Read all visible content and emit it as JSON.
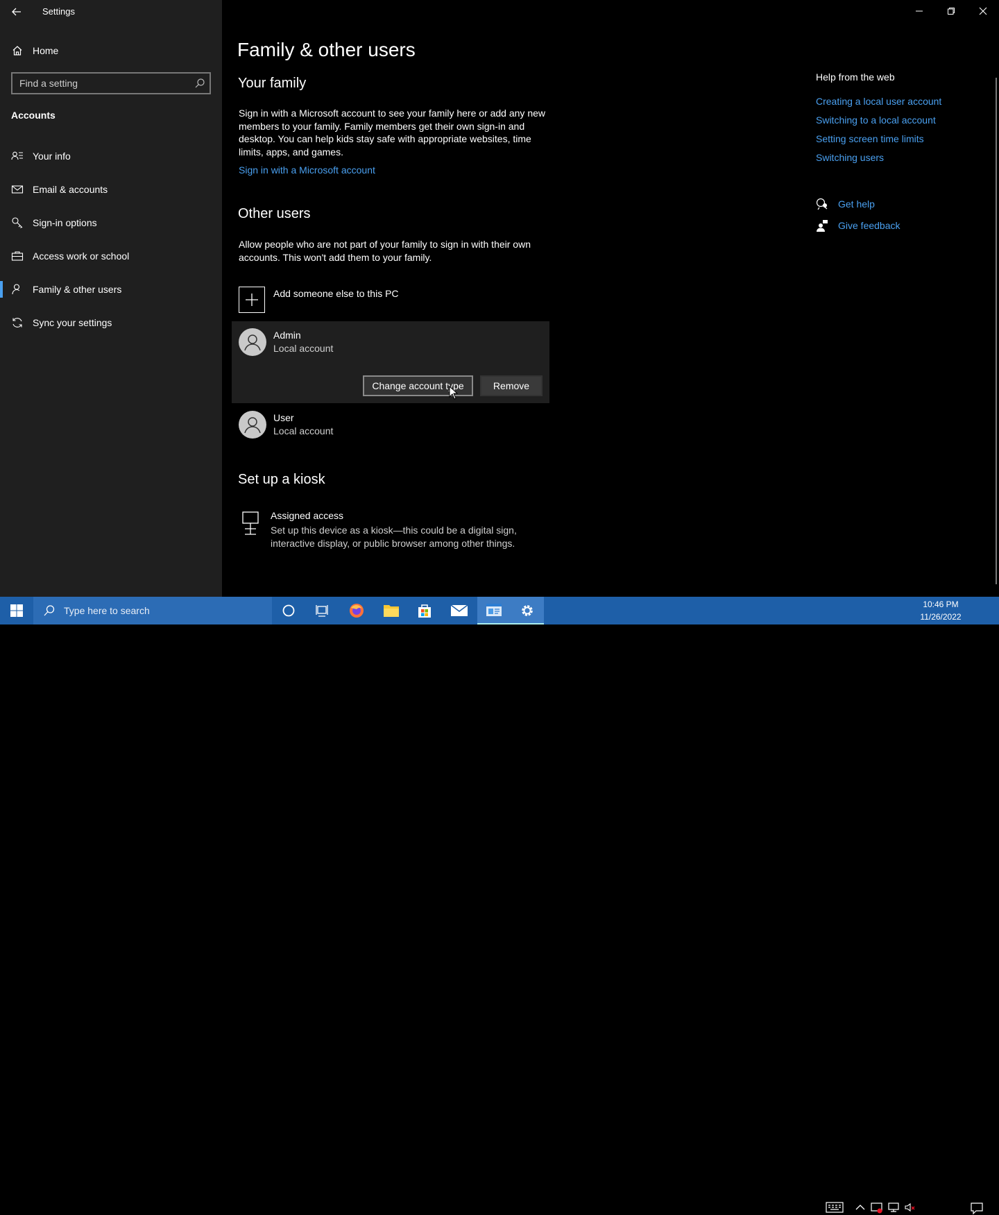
{
  "window": {
    "title": "Settings"
  },
  "sidebar": {
    "home_label": "Home",
    "search_placeholder": "Find a setting",
    "section_title": "Accounts",
    "items": [
      {
        "label": "Your info",
        "icon": "person-list-icon"
      },
      {
        "label": "Email & accounts",
        "icon": "mail-icon"
      },
      {
        "label": "Sign-in options",
        "icon": "key-icon"
      },
      {
        "label": "Access work or school",
        "icon": "briefcase-icon"
      },
      {
        "label": "Family & other users",
        "icon": "person-add-icon",
        "active": true
      },
      {
        "label": "Sync your settings",
        "icon": "sync-icon"
      }
    ]
  },
  "main": {
    "page_title": "Family & other users",
    "your_family": {
      "heading": "Your family",
      "description": "Sign in with a Microsoft account to see your family here or add any new members to your family. Family members get their own sign-in and desktop. You can help kids stay safe with appropriate websites, time limits, apps, and games.",
      "link": "Sign in with a Microsoft account"
    },
    "other_users": {
      "heading": "Other users",
      "description": "Allow people who are not part of your family to sign in with their own accounts. This won't add them to your family.",
      "add_label": "Add someone else to this PC",
      "users": [
        {
          "name": "Admin",
          "type": "Local account",
          "selected": true
        },
        {
          "name": "User",
          "type": "Local account",
          "selected": false
        }
      ],
      "change_type_button": "Change account type",
      "remove_button": "Remove"
    },
    "kiosk": {
      "heading": "Set up a kiosk",
      "title": "Assigned access",
      "description": "Set up this device as a kiosk—this could be a digital sign, interactive display, or public browser among other things."
    }
  },
  "help": {
    "title": "Help from the web",
    "links": [
      "Creating a local user account",
      "Switching to a local account",
      "Setting screen time limits",
      "Switching users"
    ],
    "get_help": "Get help",
    "give_feedback": "Give feedback"
  },
  "taskbar": {
    "search_placeholder": "Type here to search",
    "time": "10:46 PM",
    "date": "11/26/2022"
  },
  "colors": {
    "accent": "#4aa0f0",
    "sidebar_bg": "#1f1f1f",
    "taskbar_bg": "#1e5fa8"
  }
}
